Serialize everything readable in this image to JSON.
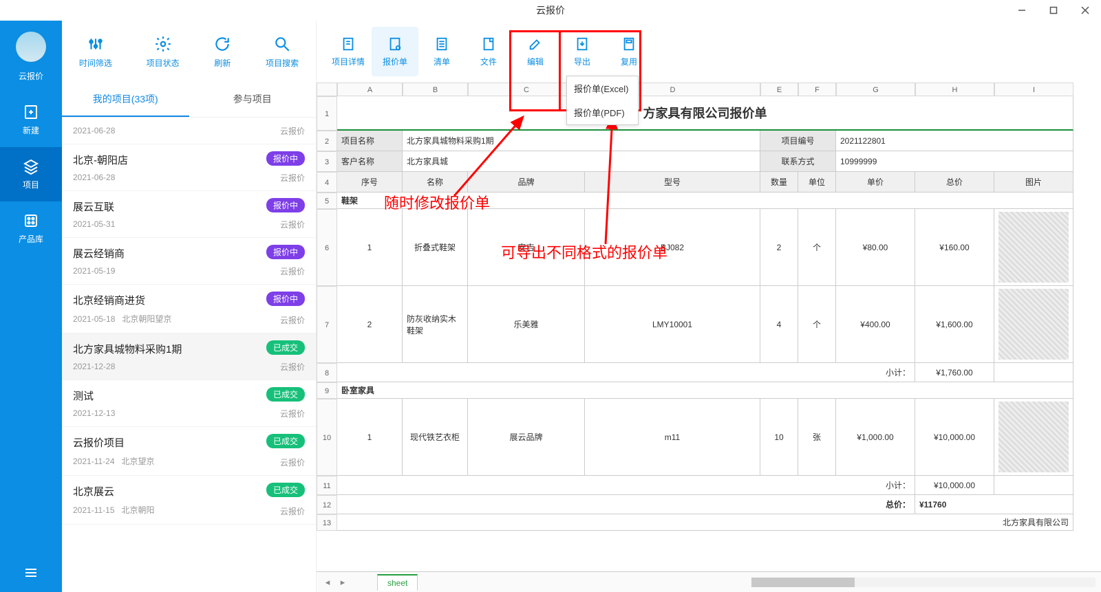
{
  "app_title": "云报价",
  "left_nav": {
    "app": "云报价",
    "items": [
      "新建",
      "项目",
      "产品库"
    ]
  },
  "project_tools": [
    "时间筛选",
    "项目状态",
    "刷新",
    "项目搜索"
  ],
  "project_tabs": {
    "mine": "我的项目(33项)",
    "joined": "参与项目"
  },
  "projects": [
    {
      "name": "",
      "date": "2021-06-28",
      "src": "云报价"
    },
    {
      "name": "北京-朝阳店",
      "date": "2021-06-28",
      "badge": "报价中",
      "src": "云报价"
    },
    {
      "name": "展云互联",
      "date": "2021-05-31",
      "badge": "报价中",
      "src": "云报价"
    },
    {
      "name": "展云经销商",
      "date": "2021-05-19",
      "badge": "报价中",
      "src": "云报价"
    },
    {
      "name": "北京经销商进货",
      "date": "2021-05-18",
      "sub": "北京朝阳望京",
      "badge": "报价中",
      "src": "云报价"
    },
    {
      "name": "北方家具城物料采购1期",
      "date": "2021-12-28",
      "badge": "已成交",
      "src": "云报价",
      "sel": true
    },
    {
      "name": "测试",
      "date": "2021-12-13",
      "badge": "已成交",
      "src": "云报价"
    },
    {
      "name": "云报价项目",
      "date": "2021-11-24",
      "sub": "北京望京",
      "badge": "已成交",
      "src": "云报价"
    },
    {
      "name": "北京展云",
      "date": "2021-11-15",
      "sub": "北京朝阳",
      "badge": "已成交",
      "src": "云报价"
    }
  ],
  "content_tools": [
    "项目详情",
    "报价单",
    "清单",
    "文件",
    "编辑",
    "导出",
    "复用"
  ],
  "export_menu": [
    "报价单(Excel)",
    "报价单(PDF)"
  ],
  "annotations": {
    "edit": "随时修改报价单",
    "export": "可导出不同格式的报价单"
  },
  "sheet": {
    "tab": "sheet",
    "cols": [
      "A",
      "B",
      "C",
      "D",
      "E",
      "F",
      "G",
      "H",
      "I"
    ],
    "title": "方家具有限公司报价单",
    "company_suffix": "北方家具有限公司",
    "meta": {
      "proj_name_lbl": "项目名称",
      "proj_name_val": "北方家具城物料采购1期",
      "proj_no_lbl": "项目编号",
      "proj_no_val": "2021122801",
      "cust_lbl": "客户名称",
      "cust_val": "北方家具城",
      "contact_lbl": "联系方式",
      "contact_val": "10999999"
    },
    "headers": [
      "序号",
      "名称",
      "品牌",
      "型号",
      "数量",
      "单位",
      "单价",
      "总价",
      "图片"
    ],
    "sections": [
      {
        "name": "鞋架",
        "rows": [
          {
            "no": "1",
            "name": "折叠式鞋架",
            "brand": "安吉",
            "model": "BJ082",
            "qty": "2",
            "unit": "个",
            "price": "¥80.00",
            "total": "¥160.00"
          },
          {
            "no": "2",
            "name": "防灰收纳实木鞋架",
            "brand": "乐美雅",
            "model": "LMY10001",
            "qty": "4",
            "unit": "个",
            "price": "¥400.00",
            "total": "¥1,600.00"
          }
        ],
        "subtotal_lbl": "小计：",
        "subtotal": "¥1,760.00"
      },
      {
        "name": "卧室家具",
        "rows": [
          {
            "no": "1",
            "name": "现代铁艺衣柜",
            "brand": "展云品牌",
            "model": "m11",
            "qty": "10",
            "unit": "张",
            "price": "¥1,000.00",
            "total": "¥10,000.00"
          }
        ],
        "subtotal_lbl": "小计：",
        "subtotal": "¥10,000.00"
      }
    ],
    "grand_lbl": "总价：",
    "grand": "¥11760"
  },
  "chart_data": {
    "type": "table",
    "title": "方家具有限公司报价单",
    "columns": [
      "序号",
      "名称",
      "品牌",
      "型号",
      "数量",
      "单位",
      "单价",
      "总价"
    ],
    "rows": [
      [
        "1",
        "折叠式鞋架",
        "安吉",
        "BJ082",
        2,
        "个",
        80.0,
        160.0
      ],
      [
        "2",
        "防灰收纳实木鞋架",
        "乐美雅",
        "LMY10001",
        4,
        "个",
        400.0,
        1600.0
      ],
      [
        "1",
        "现代铁艺衣柜",
        "展云品牌",
        "m11",
        10,
        "张",
        1000.0,
        10000.0
      ]
    ],
    "subtotals": {
      "鞋架": 1760.0,
      "卧室家具": 10000.0
    },
    "grand_total": 11760
  }
}
